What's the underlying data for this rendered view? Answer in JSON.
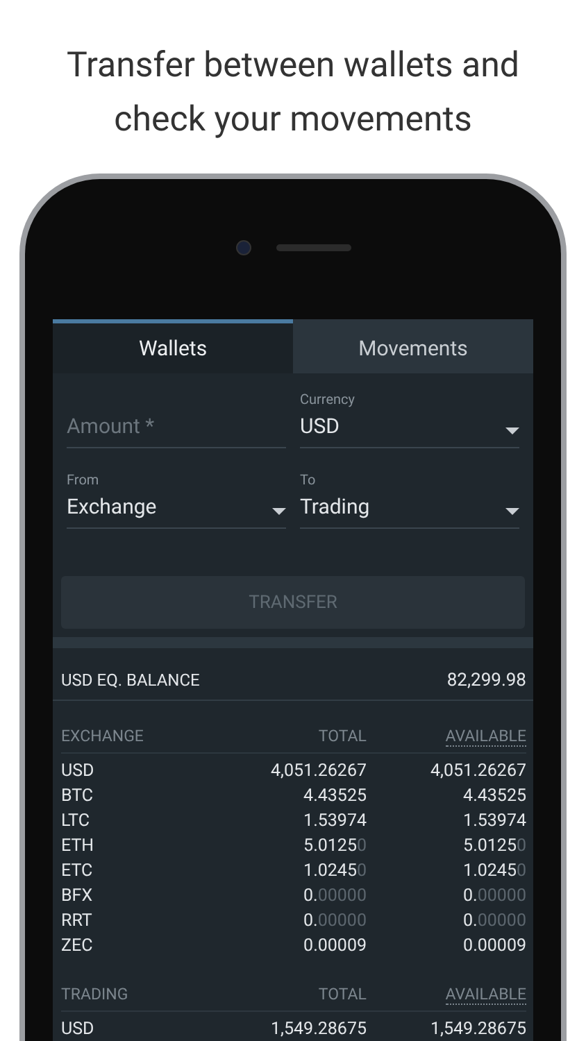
{
  "headline": "Transfer between wallets and check your movements",
  "tabs": [
    {
      "label": "Wallets",
      "selected": true
    },
    {
      "label": "Movements",
      "selected": false
    }
  ],
  "form": {
    "amount": {
      "placeholder": "Amount *"
    },
    "currency": {
      "label": "Currency",
      "value": "USD"
    },
    "from": {
      "label": "From",
      "value": "Exchange"
    },
    "to": {
      "label": "To",
      "value": "Trading"
    },
    "transfer_button": {
      "label": "TRANSFER",
      "disabled": true
    }
  },
  "balance": {
    "label": "USD EQ. BALANCE",
    "value": "82,299.98"
  },
  "wallets": [
    {
      "name": "EXCHANGE",
      "total_header": "TOTAL",
      "available_header": "AVAILABLE",
      "rows": [
        {
          "currency": "USD",
          "total": "4,051.26267",
          "total_dim": "",
          "available": "4,051.26267",
          "available_dim": ""
        },
        {
          "currency": "BTC",
          "total": "4.43525",
          "total_dim": "",
          "available": "4.43525",
          "available_dim": ""
        },
        {
          "currency": "LTC",
          "total": "1.53974",
          "total_dim": "",
          "available": "1.53974",
          "available_dim": ""
        },
        {
          "currency": "ETH",
          "total": "5.0125",
          "total_dim": "0",
          "available": "5.0125",
          "available_dim": "0"
        },
        {
          "currency": "ETC",
          "total": "1.0245",
          "total_dim": "0",
          "available": "1.0245",
          "available_dim": "0"
        },
        {
          "currency": "BFX",
          "total": "0.",
          "total_dim": "00000",
          "available": "0.",
          "available_dim": "00000"
        },
        {
          "currency": "RRT",
          "total": "0.",
          "total_dim": "00000",
          "available": "0.",
          "available_dim": "00000"
        },
        {
          "currency": "ZEC",
          "total": "0.00009",
          "total_dim": "",
          "available": "0.00009",
          "available_dim": ""
        }
      ]
    },
    {
      "name": "TRADING",
      "total_header": "TOTAL",
      "available_header": "AVAILABLE",
      "rows": [
        {
          "currency": "USD",
          "total": "1,549.28675",
          "total_dim": "",
          "available": "1,549.28675",
          "available_dim": ""
        }
      ]
    }
  ]
}
